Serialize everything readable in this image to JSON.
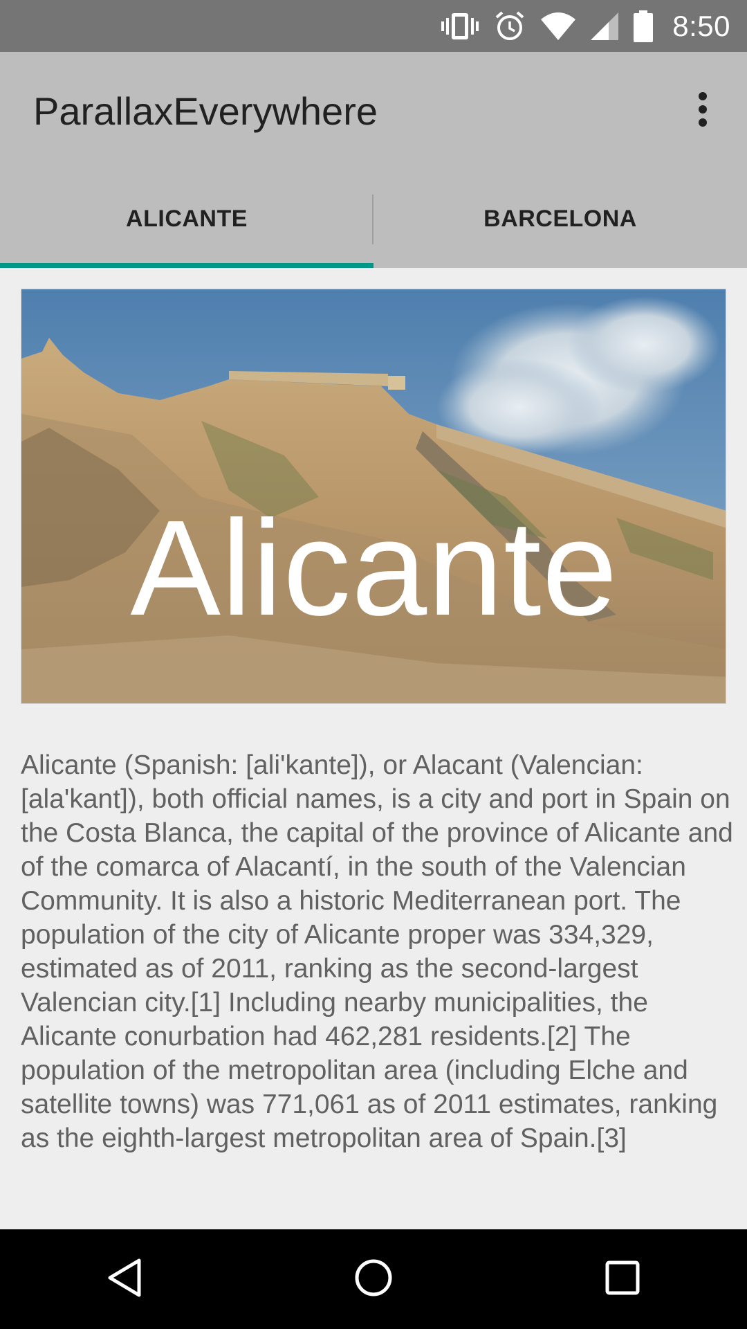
{
  "status_bar": {
    "time": "8:50",
    "icons": [
      "vibrate-icon",
      "alarm-icon",
      "wifi-icon",
      "signal-icon",
      "battery-icon"
    ]
  },
  "app_bar": {
    "title": "ParallaxEverywhere",
    "overflow_icon": "more-vert-icon"
  },
  "tabs": [
    {
      "label": "ALICANTE",
      "selected": true
    },
    {
      "label": "BARCELONA",
      "selected": false
    }
  ],
  "accent_color": "#009688",
  "hero": {
    "overlay_title": "Alicante"
  },
  "description": "Alicante (Spanish: [ali'kante]), or Alacant (Valencian: [ala'kant]), both official names, is a city and port in Spain on the Costa Blanca, the capital of the province of Alicante and of the comarca of Alacantí, in the south of the Valencian Community. It is also a historic Mediterranean port. The population of the city of Alicante proper was 334,329, estimated as of 2011, ranking as the second-largest Valencian city.[1] Including nearby municipalities, the Alicante conurbation had 462,281 residents.[2] The population of the metropolitan area (including Elche and satellite towns) was 771,061 as of 2011 estimates, ranking as the eighth-largest metropolitan area of Spain.[3]",
  "nav_bar": {
    "icons": [
      "back-icon",
      "home-icon",
      "recents-icon"
    ]
  }
}
